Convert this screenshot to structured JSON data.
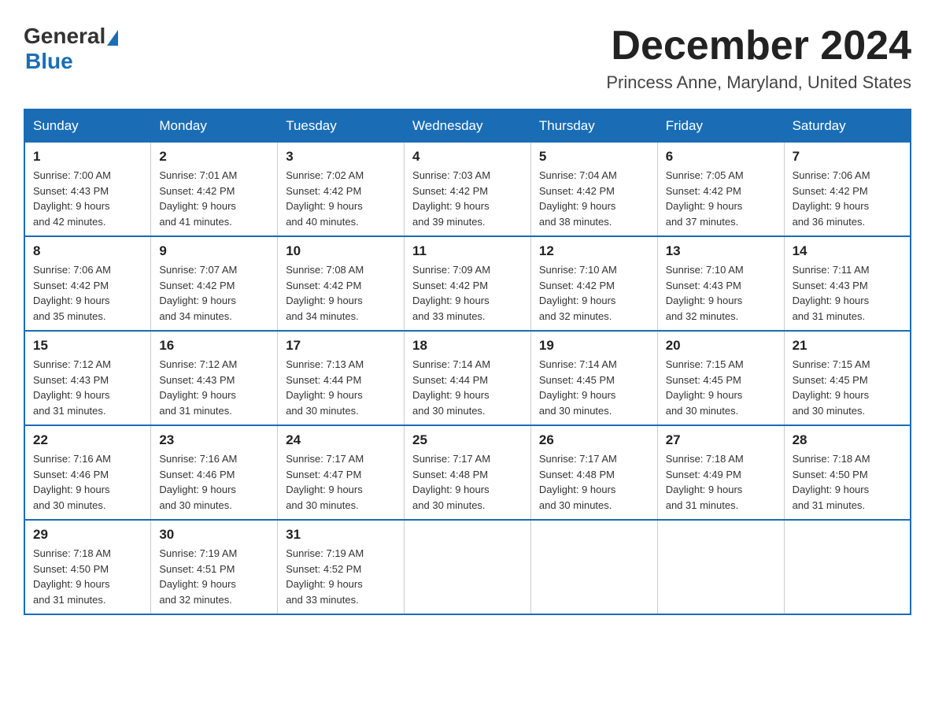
{
  "header": {
    "logo_general": "General",
    "logo_blue": "Blue",
    "month_title": "December 2024",
    "subtitle": "Princess Anne, Maryland, United States"
  },
  "weekdays": [
    "Sunday",
    "Monday",
    "Tuesday",
    "Wednesday",
    "Thursday",
    "Friday",
    "Saturday"
  ],
  "weeks": [
    [
      {
        "day": "1",
        "sunrise": "7:00 AM",
        "sunset": "4:43 PM",
        "daylight": "9 hours and 42 minutes."
      },
      {
        "day": "2",
        "sunrise": "7:01 AM",
        "sunset": "4:42 PM",
        "daylight": "9 hours and 41 minutes."
      },
      {
        "day": "3",
        "sunrise": "7:02 AM",
        "sunset": "4:42 PM",
        "daylight": "9 hours and 40 minutes."
      },
      {
        "day": "4",
        "sunrise": "7:03 AM",
        "sunset": "4:42 PM",
        "daylight": "9 hours and 39 minutes."
      },
      {
        "day": "5",
        "sunrise": "7:04 AM",
        "sunset": "4:42 PM",
        "daylight": "9 hours and 38 minutes."
      },
      {
        "day": "6",
        "sunrise": "7:05 AM",
        "sunset": "4:42 PM",
        "daylight": "9 hours and 37 minutes."
      },
      {
        "day": "7",
        "sunrise": "7:06 AM",
        "sunset": "4:42 PM",
        "daylight": "9 hours and 36 minutes."
      }
    ],
    [
      {
        "day": "8",
        "sunrise": "7:06 AM",
        "sunset": "4:42 PM",
        "daylight": "9 hours and 35 minutes."
      },
      {
        "day": "9",
        "sunrise": "7:07 AM",
        "sunset": "4:42 PM",
        "daylight": "9 hours and 34 minutes."
      },
      {
        "day": "10",
        "sunrise": "7:08 AM",
        "sunset": "4:42 PM",
        "daylight": "9 hours and 34 minutes."
      },
      {
        "day": "11",
        "sunrise": "7:09 AM",
        "sunset": "4:42 PM",
        "daylight": "9 hours and 33 minutes."
      },
      {
        "day": "12",
        "sunrise": "7:10 AM",
        "sunset": "4:42 PM",
        "daylight": "9 hours and 32 minutes."
      },
      {
        "day": "13",
        "sunrise": "7:10 AM",
        "sunset": "4:43 PM",
        "daylight": "9 hours and 32 minutes."
      },
      {
        "day": "14",
        "sunrise": "7:11 AM",
        "sunset": "4:43 PM",
        "daylight": "9 hours and 31 minutes."
      }
    ],
    [
      {
        "day": "15",
        "sunrise": "7:12 AM",
        "sunset": "4:43 PM",
        "daylight": "9 hours and 31 minutes."
      },
      {
        "day": "16",
        "sunrise": "7:12 AM",
        "sunset": "4:43 PM",
        "daylight": "9 hours and 31 minutes."
      },
      {
        "day": "17",
        "sunrise": "7:13 AM",
        "sunset": "4:44 PM",
        "daylight": "9 hours and 30 minutes."
      },
      {
        "day": "18",
        "sunrise": "7:14 AM",
        "sunset": "4:44 PM",
        "daylight": "9 hours and 30 minutes."
      },
      {
        "day": "19",
        "sunrise": "7:14 AM",
        "sunset": "4:45 PM",
        "daylight": "9 hours and 30 minutes."
      },
      {
        "day": "20",
        "sunrise": "7:15 AM",
        "sunset": "4:45 PM",
        "daylight": "9 hours and 30 minutes."
      },
      {
        "day": "21",
        "sunrise": "7:15 AM",
        "sunset": "4:45 PM",
        "daylight": "9 hours and 30 minutes."
      }
    ],
    [
      {
        "day": "22",
        "sunrise": "7:16 AM",
        "sunset": "4:46 PM",
        "daylight": "9 hours and 30 minutes."
      },
      {
        "day": "23",
        "sunrise": "7:16 AM",
        "sunset": "4:46 PM",
        "daylight": "9 hours and 30 minutes."
      },
      {
        "day": "24",
        "sunrise": "7:17 AM",
        "sunset": "4:47 PM",
        "daylight": "9 hours and 30 minutes."
      },
      {
        "day": "25",
        "sunrise": "7:17 AM",
        "sunset": "4:48 PM",
        "daylight": "9 hours and 30 minutes."
      },
      {
        "day": "26",
        "sunrise": "7:17 AM",
        "sunset": "4:48 PM",
        "daylight": "9 hours and 30 minutes."
      },
      {
        "day": "27",
        "sunrise": "7:18 AM",
        "sunset": "4:49 PM",
        "daylight": "9 hours and 31 minutes."
      },
      {
        "day": "28",
        "sunrise": "7:18 AM",
        "sunset": "4:50 PM",
        "daylight": "9 hours and 31 minutes."
      }
    ],
    [
      {
        "day": "29",
        "sunrise": "7:18 AM",
        "sunset": "4:50 PM",
        "daylight": "9 hours and 31 minutes."
      },
      {
        "day": "30",
        "sunrise": "7:19 AM",
        "sunset": "4:51 PM",
        "daylight": "9 hours and 32 minutes."
      },
      {
        "day": "31",
        "sunrise": "7:19 AM",
        "sunset": "4:52 PM",
        "daylight": "9 hours and 33 minutes."
      },
      null,
      null,
      null,
      null
    ]
  ],
  "labels": {
    "sunrise": "Sunrise:",
    "sunset": "Sunset:",
    "daylight": "Daylight:"
  }
}
